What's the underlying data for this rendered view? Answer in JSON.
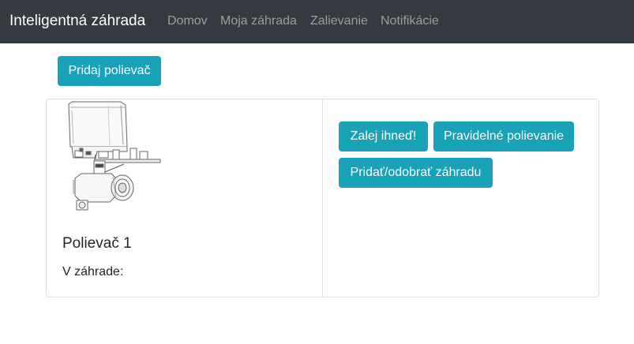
{
  "navbar": {
    "brand": "Inteligentná záhrada",
    "links": [
      "Domov",
      "Moja záhrada",
      "Zalievanie",
      "Notifikácie"
    ]
  },
  "add_sprinkler_label": "Pridaj polievač",
  "card": {
    "image_icon": "water-valve-actuator-image",
    "title": "Polievač 1",
    "garden_label": "V záhrade:",
    "actions": {
      "water_now": "Zalej ihneď!",
      "schedule": "Pravidelné polievanie",
      "add_remove_garden": "Pridať/odobrať záhradu"
    }
  },
  "colors": {
    "navbar_bg": "#343a40",
    "accent_info": "#17a2b8"
  }
}
